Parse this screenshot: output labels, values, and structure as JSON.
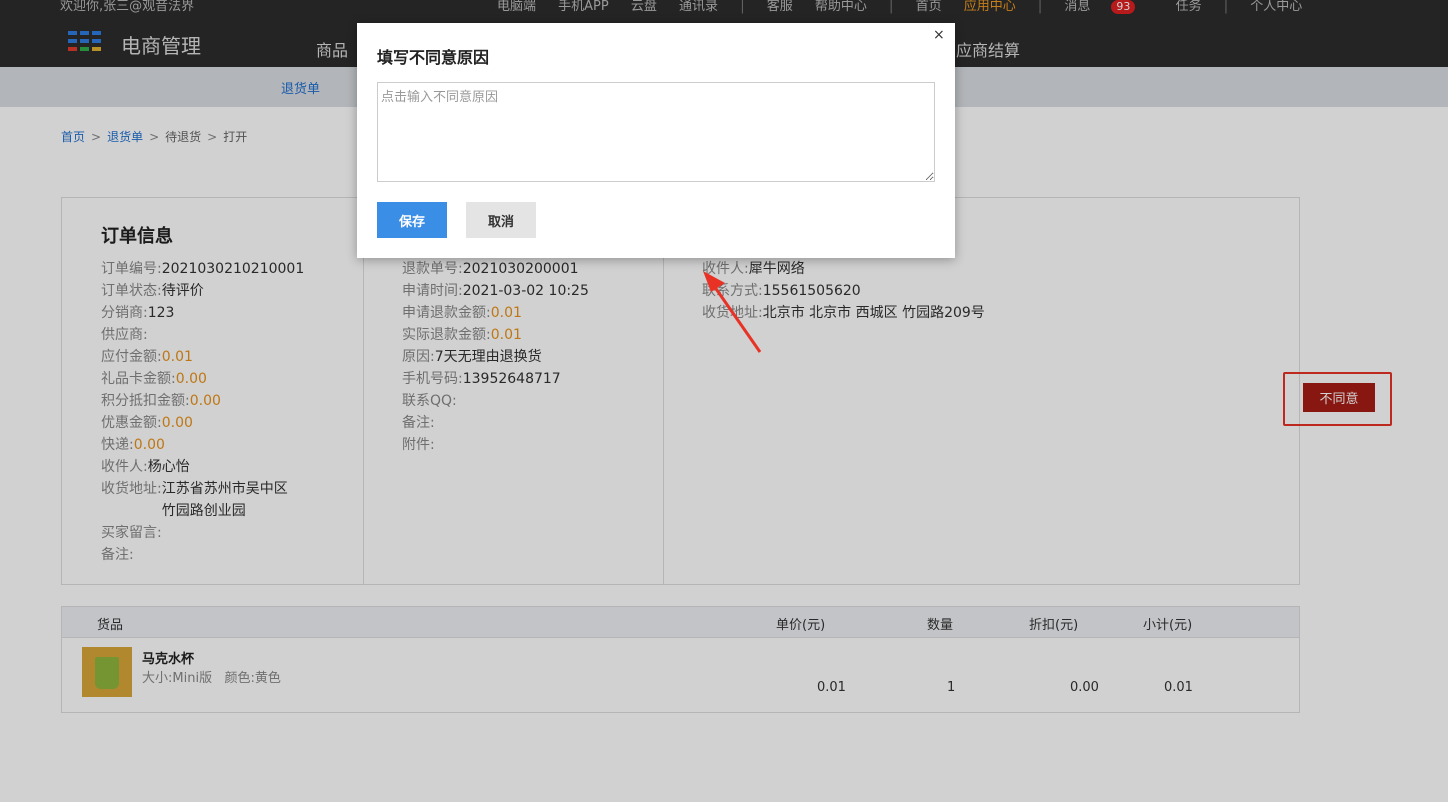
{
  "topbar": {
    "welcome": "欢迎你,张三@观音法界",
    "links": [
      "电脑端",
      "手机APP",
      "云盘",
      "通讯录"
    ],
    "links2": [
      "客服",
      "帮助中心"
    ],
    "home": "首页",
    "app_center": "应用中心",
    "messages": "消息",
    "message_count": "93",
    "tasks": "任务",
    "personal": "个人中心"
  },
  "header": {
    "brand": "电商管理",
    "nav_goods": "商品",
    "nav_supplier": "应商结算"
  },
  "subnav": {
    "returns": "退货单"
  },
  "breadcrumb": {
    "home": "首页",
    "returns": "退货单",
    "pending": "待退货",
    "open": "打开",
    "sep": ">"
  },
  "order_info": {
    "title": "订单信息",
    "rows": [
      {
        "k": "订单编号:",
        "v": "2021030210210001"
      },
      {
        "k": "订单状态:",
        "v": "待评价"
      },
      {
        "k": "分销商:",
        "v": "123"
      },
      {
        "k": "供应商:",
        "v": ""
      },
      {
        "k": "应付金额:",
        "v": "0.01"
      },
      {
        "k": "礼品卡金额:",
        "v": "0.00"
      },
      {
        "k": "积分抵扣金额:",
        "v": "0.00"
      },
      {
        "k": "优惠金额:",
        "v": "0.00"
      },
      {
        "k": "快递:",
        "v": "0.00"
      },
      {
        "k": "收件人:",
        "v": "杨心怡"
      },
      {
        "k": "收货地址:",
        "v1": "江苏省苏州市吴中区",
        "v2": "竹园路创业园"
      },
      {
        "k": "买家留言:",
        "v": ""
      },
      {
        "k": "备注:",
        "v": ""
      }
    ]
  },
  "refund_info": {
    "rows": [
      {
        "k": "退款单号:",
        "v": "2021030200001"
      },
      {
        "k": "申请时间:",
        "v": "2021-03-02 10:25"
      },
      {
        "k": "申请退款金额:",
        "v": "0.01"
      },
      {
        "k": "实际退款金额:",
        "v": "0.01"
      },
      {
        "k": "原因:",
        "v": "7天无理由退换货"
      },
      {
        "k": "手机号码:",
        "v": "13952648717"
      },
      {
        "k": "联系QQ:",
        "v": ""
      },
      {
        "k": "备注:",
        "v": ""
      },
      {
        "k": "附件:",
        "v": ""
      }
    ]
  },
  "receiver_info": {
    "rows": [
      {
        "k": "收件人:",
        "v": "犀牛网络"
      },
      {
        "k": "联系方式:",
        "v": "15561505620"
      },
      {
        "k": "收货地址:",
        "v": "北京市 北京市 西城区 竹园路209号"
      }
    ],
    "reject_label": "不同意"
  },
  "goods": {
    "headers": {
      "name": "货品",
      "price": "单价(元)",
      "qty": "数量",
      "discount": "折扣(元)",
      "subtotal": "小计(元)"
    },
    "item": {
      "name": "马克水杯",
      "size_label": "大小:",
      "size": "Mini版",
      "color_label": "颜色:",
      "color": "黄色",
      "price": "0.01",
      "qty": "1",
      "discount": "0.00",
      "subtotal": "0.01"
    }
  },
  "modal": {
    "title": "填写不同意原因",
    "close": "×",
    "placeholder": "点击输入不同意原因",
    "save": "保存",
    "cancel": "取消"
  },
  "colors": {
    "accent_orange": "#e8921a",
    "reject_red": "#a71d15",
    "save_blue": "#3a8ee6",
    "annotation": "#e83226"
  }
}
